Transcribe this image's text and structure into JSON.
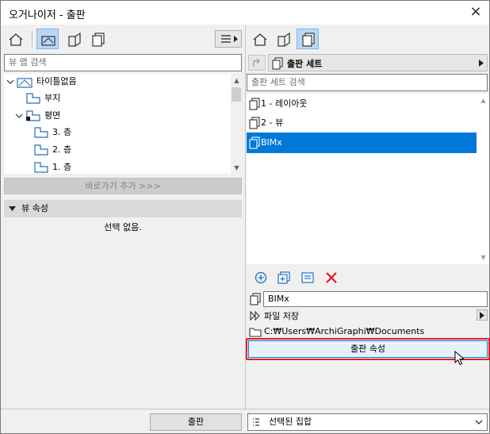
{
  "window": {
    "title": "오거나이저 - 출판",
    "close_icon": "×"
  },
  "left_panel": {
    "search": {
      "placeholder": "뷰 맵 검색",
      "value": ""
    },
    "tree": [
      {
        "label": "타이틀없음",
        "expanded": true
      },
      {
        "label": "부지"
      },
      {
        "label": "평면",
        "expanded": true
      },
      {
        "label": "3. 층"
      },
      {
        "label": "2. 층"
      },
      {
        "label": "1. 층"
      }
    ],
    "add_shortcut_label": "바로가기 추가 >>>",
    "view_props": {
      "label": "뷰 속성",
      "empty_text": "선택 없음."
    }
  },
  "right_panel": {
    "set_dropdown_label": "출판 세트",
    "search": {
      "placeholder": "출판 세트 검색",
      "value": ""
    },
    "items": [
      {
        "label": "1 - 레이아웃"
      },
      {
        "label": "2 - 뷰"
      },
      {
        "label": "BIMx",
        "selected": true
      }
    ],
    "name_field_value": "BIMx",
    "save_file_label": "파일 저장",
    "path": "C:₩Users₩ArchiGraphi₩Documents",
    "publish_props_label": "출판 속성"
  },
  "footer": {
    "publish_label": "출판",
    "select_option": "선택된 집합"
  },
  "colors": {
    "selection": "#0078d7",
    "active_tool": "#b9d7f5",
    "highlight_frame": "#e02020",
    "delete_icon": "#e81123"
  }
}
